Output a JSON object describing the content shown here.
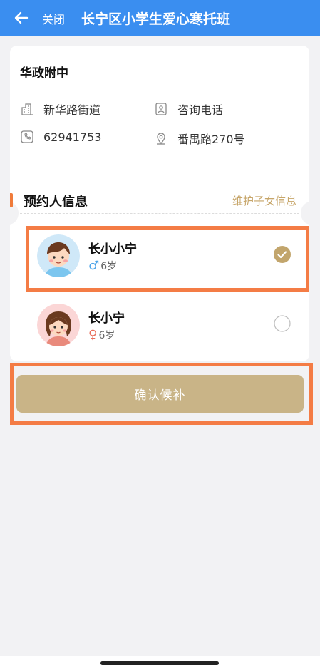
{
  "header": {
    "close_label": "关闭",
    "title": "长宁区小学生爱心寒托班",
    "background": "#3a8ef0"
  },
  "school": {
    "name": "华政附中",
    "street": "新华路街道",
    "consult_label": "咨询电话",
    "phone": "62941753",
    "address": "番禺路270号"
  },
  "section": {
    "title": "预约人信息",
    "maintain_link": "维护子女信息"
  },
  "children": [
    {
      "name": "长小小宁",
      "gender": "male",
      "gender_symbol": "♂",
      "age": "6岁",
      "selected": true
    },
    {
      "name": "长小宁",
      "gender": "female",
      "gender_symbol": "♀",
      "age": "6岁",
      "selected": false
    }
  ],
  "confirm_label": "确认候补",
  "colors": {
    "accent_gold": "#c9b487",
    "highlight": "#f47c45",
    "male": "#4aa3e8",
    "female": "#e96f5c"
  }
}
